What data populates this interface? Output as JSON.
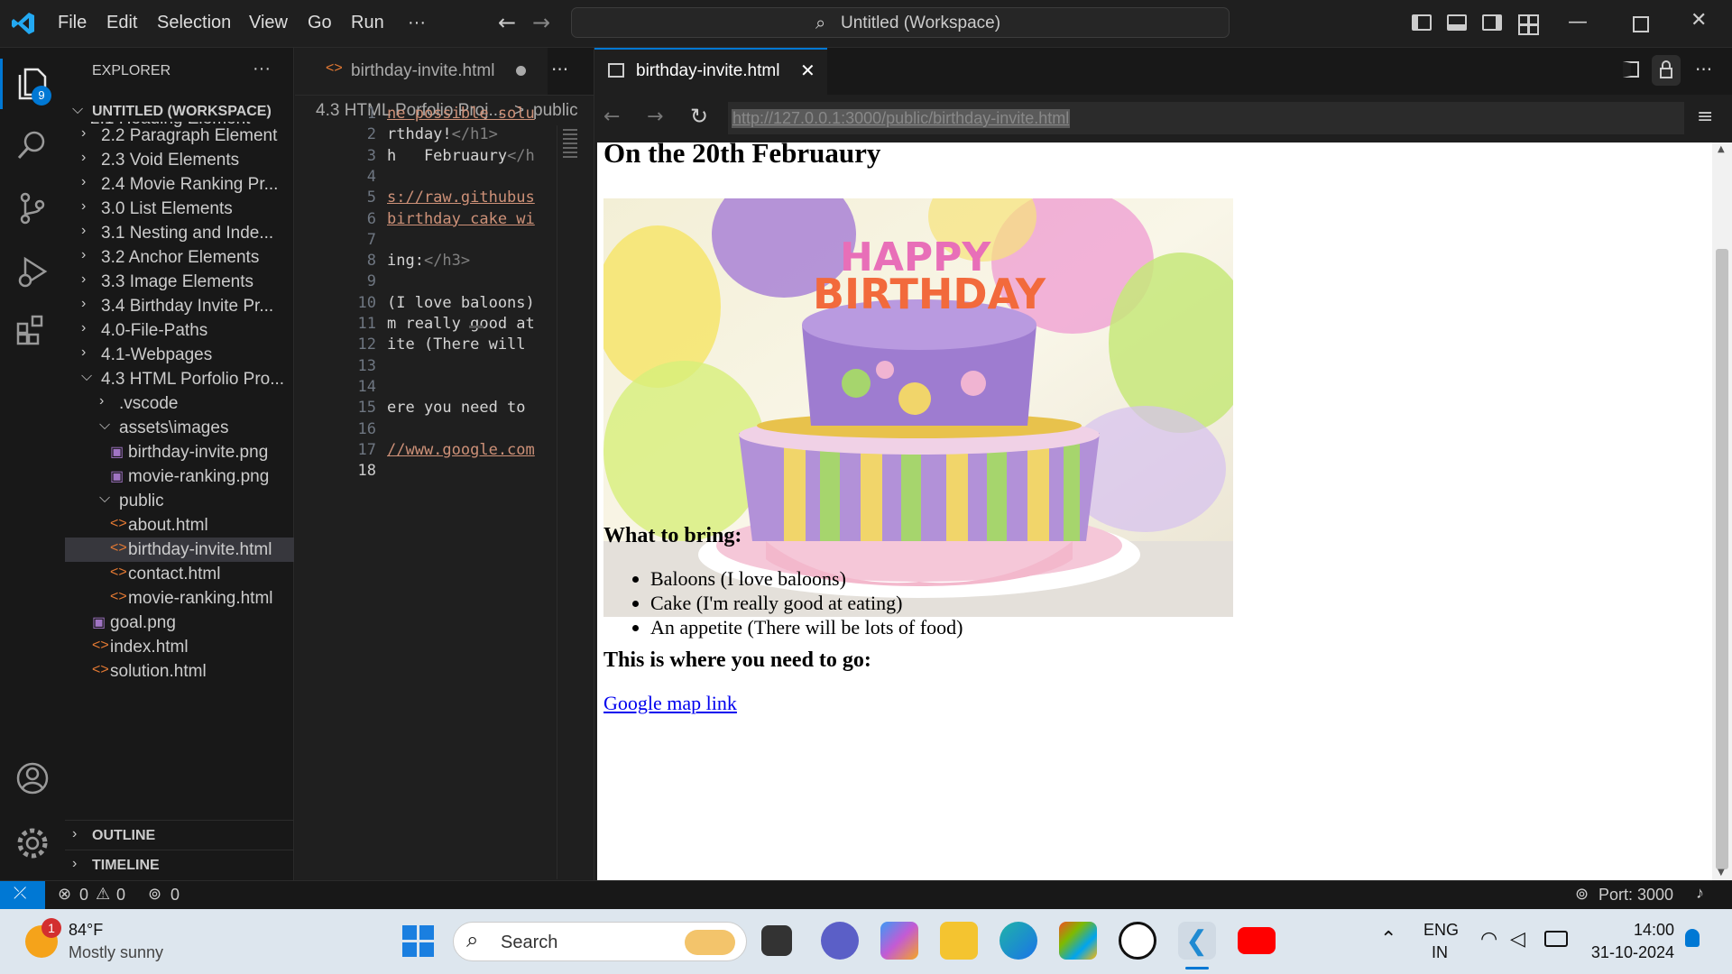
{
  "titlebar": {
    "menus": [
      "File",
      "Edit",
      "Selection",
      "View",
      "Go",
      "Run",
      "···"
    ],
    "search_text": "Untitled (Workspace)"
  },
  "activity": {
    "explorer_badge": "9"
  },
  "sidebar": {
    "title": "EXPLORER",
    "more": "···",
    "workspace": "UNTITLED (WORKSPACE)",
    "partial_item": "2.1 Heading Element",
    "items": [
      {
        "label": "2.2 Paragraph Element",
        "kind": "folder-closed"
      },
      {
        "label": "2.3 Void Elements",
        "kind": "folder-closed"
      },
      {
        "label": "2.4 Movie Ranking Pr...",
        "kind": "folder-closed"
      },
      {
        "label": "3.0 List Elements",
        "kind": "folder-closed"
      },
      {
        "label": "3.1 Nesting and Inde...",
        "kind": "folder-closed"
      },
      {
        "label": "3.2 Anchor Elements",
        "kind": "folder-closed"
      },
      {
        "label": "3.3 Image Elements",
        "kind": "folder-closed"
      },
      {
        "label": "3.4 Birthday Invite Pr...",
        "kind": "folder-closed"
      },
      {
        "label": "4.0-File-Paths",
        "kind": "folder-closed"
      },
      {
        "label": "4.1-Webpages",
        "kind": "folder-closed"
      },
      {
        "label": "4.3 HTML Porfolio Pro...",
        "kind": "folder-open"
      }
    ],
    "sub_items": [
      {
        "label": ".vscode",
        "kind": "folder-closed"
      },
      {
        "label": "assets\\images",
        "kind": "folder-open"
      },
      {
        "label": "birthday-invite.png",
        "kind": "image"
      },
      {
        "label": "movie-ranking.png",
        "kind": "image"
      },
      {
        "label": "public",
        "kind": "folder-open"
      },
      {
        "label": "about.html",
        "kind": "html"
      },
      {
        "label": "birthday-invite.html",
        "kind": "html"
      },
      {
        "label": "contact.html",
        "kind": "html"
      },
      {
        "label": "movie-ranking.html",
        "kind": "html"
      },
      {
        "label": "goal.png",
        "kind": "image"
      },
      {
        "label": "index.html",
        "kind": "html"
      },
      {
        "label": "solution.html",
        "kind": "html"
      }
    ],
    "outline": "OUTLINE",
    "timeline": "TIMELINE"
  },
  "editor": {
    "tab_label": "birthday-invite.html",
    "more": "···",
    "breadcrumb_folder": "4.3 HTML Porfolio Proj...",
    "breadcrumb_sep": ">",
    "breadcrumb_sub": "public",
    "line_numbers": [
      "1",
      "2",
      "3",
      "4",
      "5",
      "6",
      "7",
      "8",
      "9",
      "10",
      "11",
      "12",
      "13",
      "14",
      "15",
      "16",
      "17",
      "18"
    ],
    "lines": [
      {
        "text": "ne possible solu",
        "color": "#ce9178"
      },
      {
        "text": "rthday!",
        "color": "#d4d4d4",
        "tag": "</h1>"
      },
      {
        "text": "h   Februaury",
        "color": "#d4d4d4",
        "tag": "</h"
      },
      {
        "text": "",
        "color": "#d4d4d4"
      },
      {
        "text": "s://raw.githubus",
        "color": "#ce9178"
      },
      {
        "text": "birthday cake wi",
        "color": "#ce9178"
      },
      {
        "text": "",
        "color": "#d4d4d4"
      },
      {
        "text": "ing:",
        "color": "#d4d4d4",
        "tag": "</h3>"
      },
      {
        "text": "",
        "color": "#d4d4d4"
      },
      {
        "text": "(I love baloons)",
        "color": "#d4d4d4"
      },
      {
        "text": "m really good at",
        "color": "#d4d4d4"
      },
      {
        "text": "ite (There will ",
        "color": "#d4d4d4"
      },
      {
        "text": "",
        "color": "#d4d4d4"
      },
      {
        "text": "",
        "color": "#d4d4d4"
      },
      {
        "text": "ere you need to ",
        "color": "#d4d4d4"
      },
      {
        "text": "",
        "color": "#d4d4d4"
      },
      {
        "text": "//www.google.com",
        "color": "#ce9178"
      },
      {
        "text": "",
        "color": "#d4d4d4"
      }
    ]
  },
  "preview": {
    "tab_label": "birthday-invite.html",
    "url": "http://127.0.0.1:3000/public/birthday-invite.html",
    "heading_date": "On the 20th Februaury",
    "cake_text": "HAPPY BIRTHDAY",
    "bring_heading": "What to bring:",
    "bring_items": [
      "Baloons (I love baloons)",
      "Cake (I'm really good at eating)",
      "An appetite (There will be lots of food)"
    ],
    "where_heading": "This is where you need to go:",
    "map_link": "Google map link"
  },
  "status": {
    "errors": "0",
    "warnings": "0",
    "ports": "0",
    "port_label": "Port: 3000"
  },
  "taskbar": {
    "weather_badge": "1",
    "temp": "84°F",
    "weather": "Mostly sunny",
    "search": "Search",
    "lang1": "ENG",
    "lang2": "IN",
    "time": "14:00",
    "date": "31-10-2024"
  },
  "colors": {
    "accent": "#0078d4",
    "html_icon": "#e37933",
    "image_icon": "#a074c4",
    "link": "#0000ee"
  }
}
